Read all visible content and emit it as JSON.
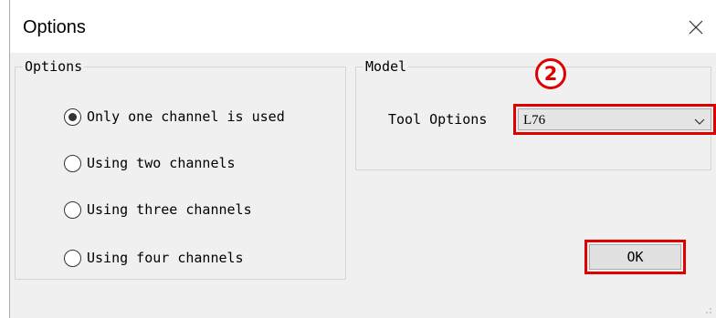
{
  "window": {
    "title": "Options"
  },
  "options_group": {
    "legend": "Options",
    "radios": [
      {
        "label": "Only one channel is used",
        "selected": true
      },
      {
        "label": "Using two channels",
        "selected": false
      },
      {
        "label": "Using three channels",
        "selected": false
      },
      {
        "label": "Using four channels",
        "selected": false
      }
    ]
  },
  "model_group": {
    "legend": "Model",
    "tool_options_label": "Tool Options",
    "tool_options_value": "L76"
  },
  "annotation": {
    "badge": "2",
    "highlight_color": "#e00000"
  },
  "buttons": {
    "ok_label": "OK"
  },
  "icons": {
    "close": "close-icon",
    "dropdown": "chevron-down-icon",
    "resize": "resize-grip-icon"
  }
}
